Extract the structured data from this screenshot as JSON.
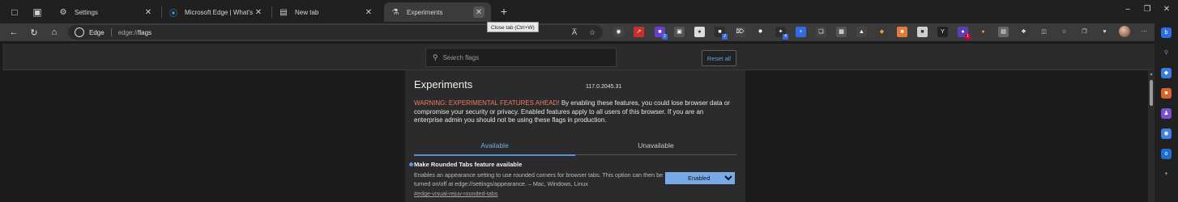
{
  "tabs": [
    {
      "title": "Settings",
      "icon": "gear-icon"
    },
    {
      "title": "Microsoft Edge | What's New",
      "icon": "edge-logo-icon"
    },
    {
      "title": "New tab",
      "icon": "newtab-icon"
    },
    {
      "title": "Experiments",
      "icon": "flask-icon",
      "active": true
    }
  ],
  "tooltip": "Close tab (Ctrl+W)",
  "omnibox": {
    "site": "Edge",
    "url_prefix": "edge://",
    "url_path": "flags"
  },
  "toolbar": {
    "read_aloud": "A̅"
  },
  "search": {
    "placeholder": "Search flags"
  },
  "reset_label": "Reset all",
  "experiments": {
    "title": "Experiments",
    "version": "117.0.2045.31",
    "warning_label": "WARNING: EXPERIMENTAL FEATURES AHEAD!",
    "warning_text": " By enabling these features, you could lose browser data or compromise your security or privacy. Enabled features apply to all users of this browser. If you are an enterprise admin you should not be using these flags in production.",
    "tab_available": "Available",
    "tab_unavailable": "Unavailable"
  },
  "flag": {
    "name": "Make Rounded Tabs feature available",
    "description": "Enables an appearance setting to use rounded corners for browser tabs. This option can then be turned on/off at edge://settings/appearance. – Mac, Windows, Linux",
    "link": "#edge-visual-rejuv-rounded-tabs",
    "value": "Enabled"
  },
  "extension_badges": {
    "ext2": "2",
    "ext5": "2",
    "ext8": "4",
    "ext14": "1",
    "ext19": "1"
  },
  "colors": {
    "accent": "#5a94e0",
    "warning": "#f07a6a"
  }
}
